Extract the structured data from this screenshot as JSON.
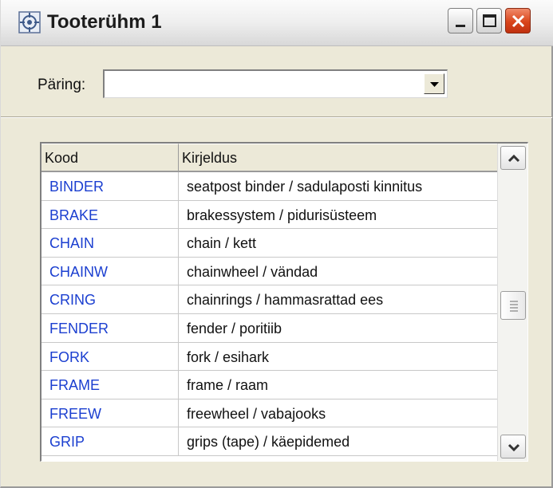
{
  "window": {
    "title": "Tooterühm 1",
    "icons": {
      "app": "grid-app-icon",
      "minimize": "minimize-icon",
      "maximize": "maximize-icon",
      "close": "close-icon"
    }
  },
  "query": {
    "label": "Päring:",
    "value": ""
  },
  "table": {
    "columns": [
      "Kood",
      "Kirjeldus"
    ],
    "rows": [
      {
        "code": "BINDER",
        "description": "seatpost binder / sadulaposti kinnitus"
      },
      {
        "code": "BRAKE",
        "description": "brakessystem / pidurisüsteem"
      },
      {
        "code": "CHAIN",
        "description": "chain / kett"
      },
      {
        "code": "CHAINW",
        "description": "chainwheel / vändad"
      },
      {
        "code": "CRING",
        "description": "chainrings / hammasrattad ees"
      },
      {
        "code": "FENDER",
        "description": "fender / poritiib"
      },
      {
        "code": "FORK",
        "description": "fork / esihark"
      },
      {
        "code": "FRAME",
        "description": "frame / raam"
      },
      {
        "code": "FREEW",
        "description": "freewheel / vabajooks"
      },
      {
        "code": "GRIP",
        "description": "grips (tape) / käepidemed"
      }
    ]
  },
  "colors": {
    "code_text": "#1b3fd0",
    "window_bg": "#ece9d8",
    "close_button": "#d9451b"
  }
}
